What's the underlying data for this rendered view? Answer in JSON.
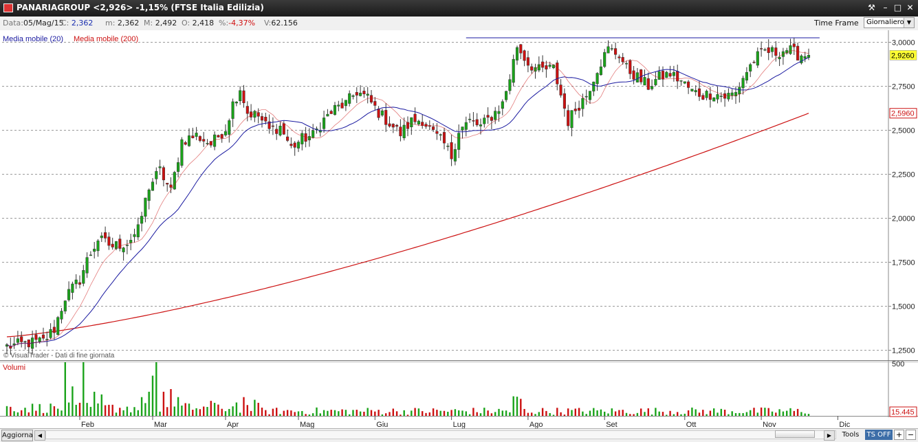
{
  "window": {
    "title": "PANARIAGROUP <2,926> -1,15%  (FTSE Italia Edilizia)",
    "buttons": {
      "tools": "⚒",
      "minimize": "–",
      "maximize": "□",
      "close": "✕"
    }
  },
  "info": {
    "data_label": "Data:",
    "data_value": "05/Mag/15",
    "c_label": "C:",
    "c_value": "2,362",
    "m_label": "m:",
    "m_value": "2,362",
    "M_label": "M:",
    "M_value": "2,492",
    "o_label": "O:",
    "o_value": "2,418",
    "pct_label": "%:",
    "pct_value": "-4,37%",
    "v_label": "V:",
    "v_value": "62.156",
    "timeframe_label": "Time Frame",
    "timeframe_value": "Giornaliero"
  },
  "legend": {
    "ma20": "Media mobile (20)",
    "ma200": "Media mobile (200)"
  },
  "watermark": "© VisualTrader - Dati di fine giornata",
  "volume_label": "Volumi",
  "bottom": {
    "update": "Aggiorna",
    "tools": "Tools",
    "tsoff": "TS OFF",
    "plus": "+",
    "minus": "−"
  },
  "colors": {
    "up": "#1aa31a",
    "down": "#cc1111",
    "ma20": "#1a1aa0",
    "ma200": "#cc1111",
    "last": "#ffff33",
    "ma200_tag": "#cc1111"
  },
  "chart_data": {
    "type": "candlestick",
    "title": "PANARIAGROUP <2,926> -1,15%  (FTSE Italia Edilizia)",
    "y_ticks": [
      "3,0000",
      "2,7500",
      "2,5000",
      "2,2500",
      "2,0000",
      "1,7500",
      "1,5000",
      "1,2500"
    ],
    "y_tick_values": [
      3.0,
      2.75,
      2.5,
      2.25,
      2.0,
      1.75,
      1.5,
      1.25
    ],
    "ylim": [
      1.2,
      3.06
    ],
    "x_ticks": [
      "Feb",
      "Mar",
      "Apr",
      "Mag",
      "Giu",
      "Lug",
      "Ago",
      "Set",
      "Ott",
      "Nov",
      "Dic"
    ],
    "x_tick_bar_index": [
      20,
      40,
      60,
      80,
      101,
      122,
      143,
      164,
      186,
      207,
      228
    ],
    "last_price_label": "2,9260",
    "last_price": 2.926,
    "ma200_label": "2,5960",
    "ma200_last": 2.596,
    "resistance_level": 3.025,
    "resistance_range": [
      126,
      223
    ],
    "series_hint": [
      [
        0,
        1.27
      ],
      [
        6,
        1.29
      ],
      [
        10,
        1.3
      ],
      [
        13,
        1.37
      ],
      [
        16,
        1.55
      ],
      [
        20,
        1.65
      ],
      [
        22,
        1.76
      ],
      [
        25,
        1.88
      ],
      [
        29,
        1.84
      ],
      [
        33,
        1.86
      ],
      [
        36,
        1.93
      ],
      [
        39,
        2.18
      ],
      [
        42,
        2.27
      ],
      [
        45,
        2.15
      ],
      [
        48,
        2.44
      ],
      [
        52,
        2.47
      ],
      [
        56,
        2.42
      ],
      [
        60,
        2.51
      ],
      [
        62,
        2.65
      ],
      [
        64,
        2.74
      ],
      [
        66,
        2.6
      ],
      [
        69,
        2.58
      ],
      [
        72,
        2.5
      ],
      [
        75,
        2.52
      ],
      [
        78,
        2.4
      ],
      [
        81,
        2.45
      ],
      [
        84,
        2.47
      ],
      [
        87,
        2.56
      ],
      [
        90,
        2.62
      ],
      [
        93,
        2.65
      ],
      [
        96,
        2.72
      ],
      [
        99,
        2.68
      ],
      [
        102,
        2.6
      ],
      [
        105,
        2.54
      ],
      [
        108,
        2.48
      ],
      [
        111,
        2.55
      ],
      [
        114,
        2.56
      ],
      [
        117,
        2.48
      ],
      [
        120,
        2.42
      ],
      [
        122,
        2.35
      ],
      [
        124,
        2.5
      ],
      [
        127,
        2.55
      ],
      [
        130,
        2.52
      ],
      [
        133,
        2.58
      ],
      [
        136,
        2.65
      ],
      [
        138,
        2.8
      ],
      [
        140,
        2.98
      ],
      [
        143,
        2.88
      ],
      [
        146,
        2.84
      ],
      [
        150,
        2.85
      ],
      [
        152,
        2.7
      ],
      [
        154,
        2.55
      ],
      [
        156,
        2.62
      ],
      [
        159,
        2.7
      ],
      [
        162,
        2.85
      ],
      [
        165,
        2.96
      ],
      [
        168,
        2.93
      ],
      [
        170,
        2.85
      ],
      [
        173,
        2.8
      ],
      [
        176,
        2.75
      ],
      [
        179,
        2.8
      ],
      [
        182,
        2.82
      ],
      [
        185,
        2.78
      ],
      [
        188,
        2.72
      ],
      [
        191,
        2.7
      ],
      [
        194,
        2.71
      ],
      [
        197,
        2.69
      ],
      [
        200,
        2.71
      ],
      [
        202,
        2.8
      ],
      [
        205,
        2.9
      ],
      [
        208,
        2.95
      ],
      [
        211,
        2.94
      ],
      [
        214,
        2.96
      ],
      [
        217,
        2.93
      ],
      [
        220,
        2.926
      ]
    ],
    "volume": {
      "label": "Volumi",
      "y_ticks": [
        "500",
        "15.445"
      ],
      "y_tick_values": [
        500,
        15.445
      ]
    }
  }
}
